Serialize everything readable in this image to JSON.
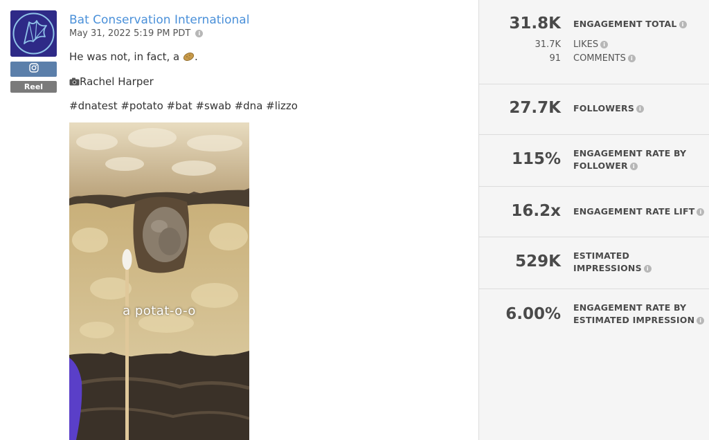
{
  "post": {
    "author": "Bat Conservation International",
    "timestamp": "May 31, 2022 5:19 PM PDT",
    "type_badge": "Reel",
    "platform_icon": "instagram-icon",
    "line1_text": "He was not, in fact, a ",
    "line1_end": ".",
    "line1_emoji": "potato-emoji",
    "line2_text": "Rachel Harper",
    "line2_icon": "camera-emoji",
    "hashtags": "#dnatest #potato #bat #swab #dna #lizzo",
    "media_overlay_text": "a potat-o-o"
  },
  "stats": {
    "engagement_total": {
      "value": "31.8K",
      "label": "ENGAGEMENT TOTAL"
    },
    "likes": {
      "value": "31.7K",
      "label": "LIKES"
    },
    "comments": {
      "value": "91",
      "label": "COMMENTS"
    },
    "followers": {
      "value": "27.7K",
      "label": "FOLLOWERS"
    },
    "engagement_rate_follower": {
      "value": "115%",
      "label": "ENGAGEMENT RATE BY FOLLOWER"
    },
    "engagement_rate_lift": {
      "value": "16.2x",
      "label": "ENGAGEMENT RATE LIFT"
    },
    "estimated_impressions": {
      "value": "529K",
      "label": "ESTIMATED IMPRESSIONS"
    },
    "engagement_rate_impression": {
      "value": "6.00%",
      "label": "ENGAGEMENT RATE BY ESTIMATED IMPRESSION"
    }
  },
  "colors": {
    "link": "#4a90d9",
    "avatar_bg": "#2e2a87",
    "platform_badge": "#5b7faa",
    "type_badge": "#7a7a7a",
    "panel_bg": "#f5f5f5"
  }
}
